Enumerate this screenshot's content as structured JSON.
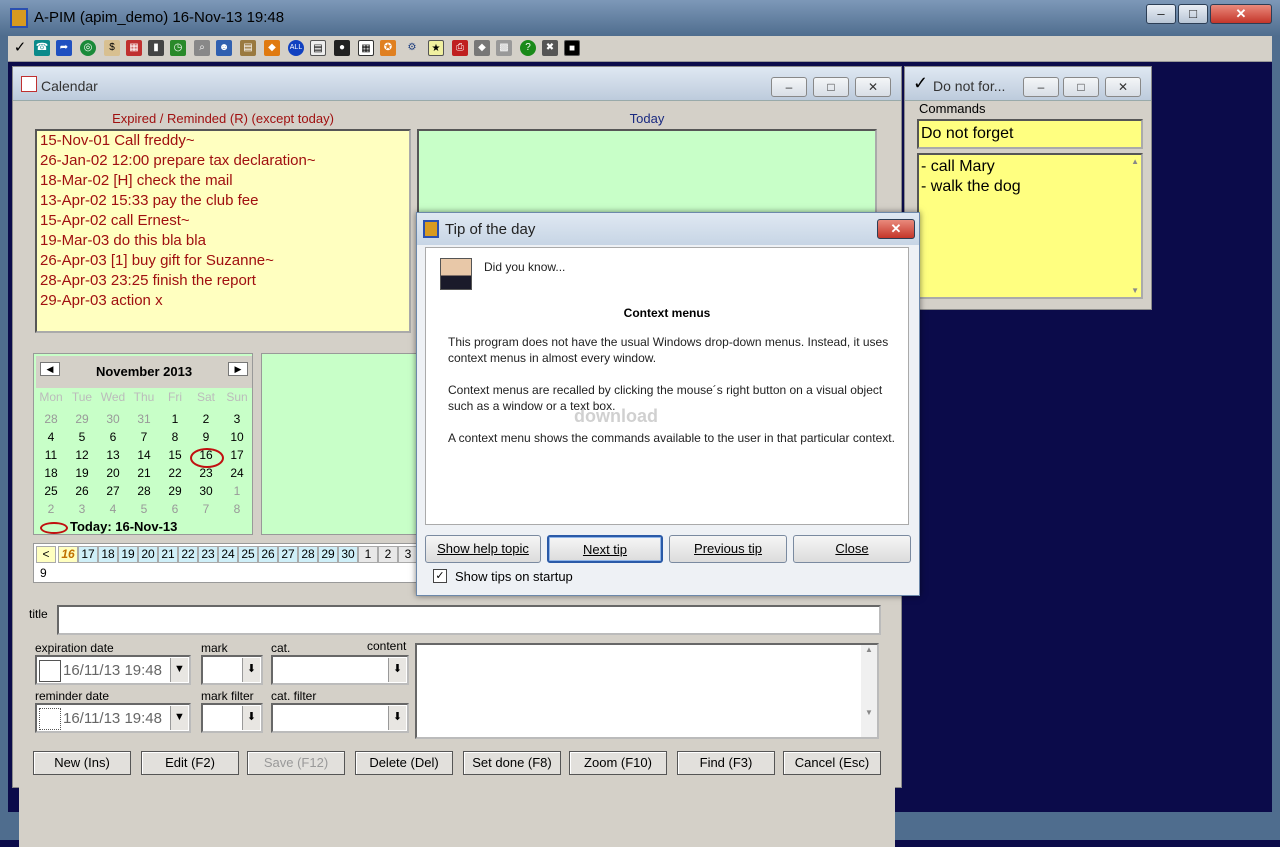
{
  "app": {
    "title": "A-PIM (apim_demo) 16-Nov-13 19:48"
  },
  "calendar": {
    "title": "Calendar",
    "expired_header": "Expired / Reminded (R) (except today)",
    "today_header": "Today",
    "expired_items": [
      "15-Nov-01 Call freddy~",
      "26-Jan-02 12:00 prepare tax declaration~",
      "18-Mar-02 [H] check the mail",
      "13-Apr-02 15:33 pay the club fee",
      "15-Apr-02 call Ernest~",
      "19-Mar-03 do this bla bla",
      "26-Apr-03 [1] buy gift for Suzanne~",
      "28-Apr-03 23:25 finish the report",
      "29-Apr-03 action x"
    ],
    "month_label": "November 2013",
    "weekdays": [
      "Mon",
      "Tue",
      "Wed",
      "Thu",
      "Fri",
      "Sat",
      "Sun"
    ],
    "weeks": [
      [
        "28",
        "29",
        "30",
        "31",
        "1",
        "2",
        "3"
      ],
      [
        "4",
        "5",
        "6",
        "7",
        "8",
        "9",
        "10"
      ],
      [
        "11",
        "12",
        "13",
        "14",
        "15",
        "16",
        "17"
      ],
      [
        "18",
        "19",
        "20",
        "21",
        "22",
        "23",
        "24"
      ],
      [
        "25",
        "26",
        "27",
        "28",
        "29",
        "30",
        "1"
      ],
      [
        "2",
        "3",
        "4",
        "5",
        "6",
        "7",
        "8"
      ]
    ],
    "today_label": "Today: 16-Nov-13",
    "strip_prev": "<",
    "strip_days": [
      "16",
      "17",
      "18",
      "19",
      "20",
      "21",
      "22",
      "23",
      "24",
      "25",
      "26",
      "27",
      "28",
      "29",
      "30",
      "1",
      "2",
      "3"
    ],
    "strip_row2": "9"
  },
  "form": {
    "title_label": "title",
    "expiration_label": "expiration date",
    "expiration_value": "16/11/13 19:48",
    "mark_label": "mark",
    "cat_label": "cat.",
    "content_label": "content",
    "reminder_label": "reminder date",
    "reminder_value": "16/11/13 19:48",
    "mark_filter_label": "mark filter",
    "cat_filter_label": "cat. filter",
    "buttons": [
      "New (Ins)",
      "Edit (F2)",
      "Save (F12)",
      "Delete (Del)",
      "Set done (F8)",
      "Zoom (F10)",
      "Find (F3)",
      "Cancel (Esc)"
    ]
  },
  "notes": {
    "title": "Do not for...",
    "commands_label": "Commands",
    "heading": "Do not forget",
    "items": [
      "- call Mary",
      "- walk the dog"
    ]
  },
  "tip": {
    "title": "Tip of the day",
    "intro": "Did you know...",
    "heading": "Context menus",
    "p1": "This program does not have the usual Windows drop-down menus. Instead, it uses context menus in almost every window.",
    "p2": "Context menus are recalled by clicking the mouse´s right button on a visual object such as a window or a text box.",
    "p3": "A context menu shows the commands available to the user in that particular context.",
    "btn_help": "Show help topic",
    "btn_next": "Next tip",
    "btn_prev": "Previous tip",
    "btn_close": "Close",
    "checkbox_label": "Show tips on startup",
    "watermark": "download"
  },
  "colors": {
    "accent_red": "#a01010",
    "list_bg": "#ffffc0",
    "green_bg": "#c8ffc8",
    "desktop": "#0b0b4a"
  }
}
